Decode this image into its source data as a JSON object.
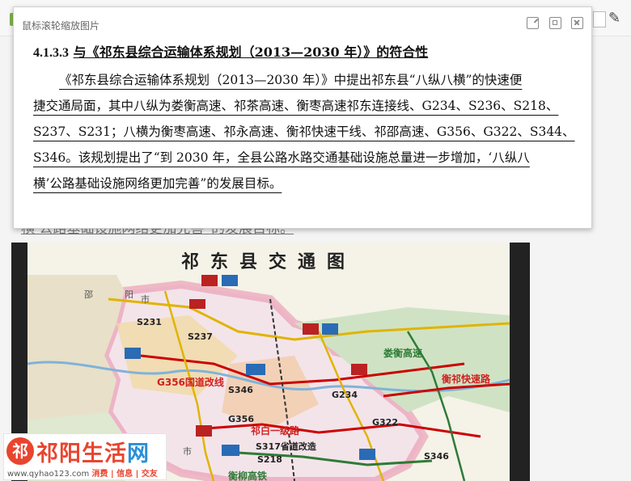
{
  "viewer": {
    "title": "鼠标滚轮缩放图片",
    "buttons": [
      "open-original",
      "restore",
      "close"
    ]
  },
  "document": {
    "section_number": "4.1.3.3",
    "heading": "与《祁东县综合运输体系规划（2013—2030 年）》的符合性",
    "lines": [
      "《祁东县综合运输体系规划（2013—2030 年）》中提出祁东县“八纵八横”的快速便",
      "捷交通局面，其中八纵为娄衡高速、祁茶高速、衡枣高速祁东连接线、G234、S236、S218、",
      "S237、S231；八横为衡枣高速、祁永高速、衡祁快速干线、祁邵高速、G356、G322、S344、",
      "S346。该规划提出了“到 2030 年，全县公路水路交通基础设施总量进一步增加，‘八纵八",
      "横’公路基础设施网络更加完善”的发展目标。"
    ]
  },
  "background": {
    "partial_text": "横’公路基础设施网络更加完善”的发展目标。"
  },
  "map": {
    "title": "祁东县交通图",
    "labels": [
      {
        "id": "shaoyang",
        "text": "邵",
        "style": "gray"
      },
      {
        "id": "yang",
        "text": "阳",
        "style": "gray"
      },
      {
        "id": "shi1",
        "text": "市",
        "style": "gray"
      },
      {
        "id": "s231",
        "text": "S231",
        "style": ""
      },
      {
        "id": "s237",
        "text": "S237",
        "style": ""
      },
      {
        "id": "louheng",
        "text": "娄衡高速",
        "style": "green"
      },
      {
        "id": "g356",
        "text": "G356国道改线",
        "style": "red"
      },
      {
        "id": "s346a",
        "text": "S346",
        "style": ""
      },
      {
        "id": "g234",
        "text": "G234",
        "style": ""
      },
      {
        "id": "hengqi",
        "text": "衡祁快速路",
        "style": "red"
      },
      {
        "id": "s356",
        "text": "G356",
        "style": ""
      },
      {
        "id": "qiyi",
        "text": "祁白一级路",
        "style": "red"
      },
      {
        "id": "g322",
        "text": "G322",
        "style": ""
      },
      {
        "id": "s317",
        "text": "S317省道改造",
        "style": ""
      },
      {
        "id": "s218",
        "text": "S218",
        "style": ""
      },
      {
        "id": "shi2",
        "text": "市",
        "style": "gray"
      },
      {
        "id": "s346b",
        "text": "S346",
        "style": ""
      },
      {
        "id": "hengliu",
        "text": "衡柳高铁",
        "style": "green"
      }
    ]
  },
  "logo": {
    "badge": "祁",
    "name_part1": "祁阳",
    "name_part2": "生活",
    "name_part3": "网",
    "url": "www.qyhao123.com",
    "tags": "消费 | 信息 | 交友"
  },
  "colors": {
    "accent": "#e8452f",
    "blue": "#2a8fd6",
    "map_bg": "#f5f2e8"
  }
}
